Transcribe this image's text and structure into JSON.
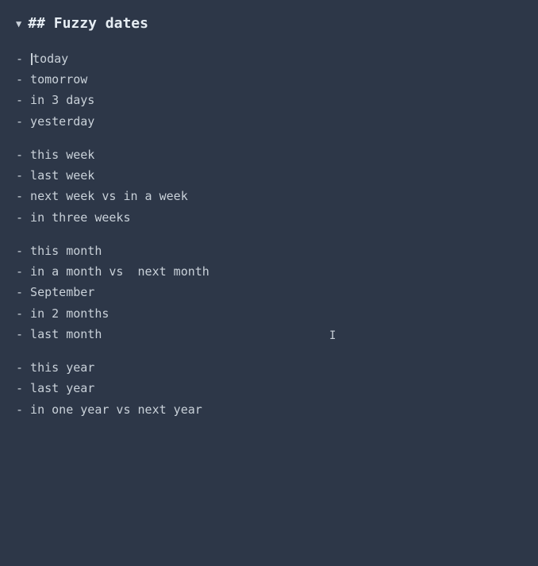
{
  "heading": {
    "arrow": "▼",
    "text": "## Fuzzy dates"
  },
  "cursor_char": "I",
  "sections": [
    {
      "id": "days",
      "items": [
        "- ▌today",
        "- tomorrow",
        "- in 3 days",
        "- yesterday"
      ]
    },
    {
      "id": "weeks",
      "items": [
        "- this week",
        "- last week",
        "- next week vs in a week",
        "- in three weeks"
      ]
    },
    {
      "id": "months",
      "items": [
        "- this month",
        "- in a month vs  next month",
        "- September",
        "- in 2 months",
        "- last month"
      ]
    },
    {
      "id": "years",
      "items": [
        "- this year",
        "- last year",
        "- in one year vs next year"
      ]
    }
  ]
}
